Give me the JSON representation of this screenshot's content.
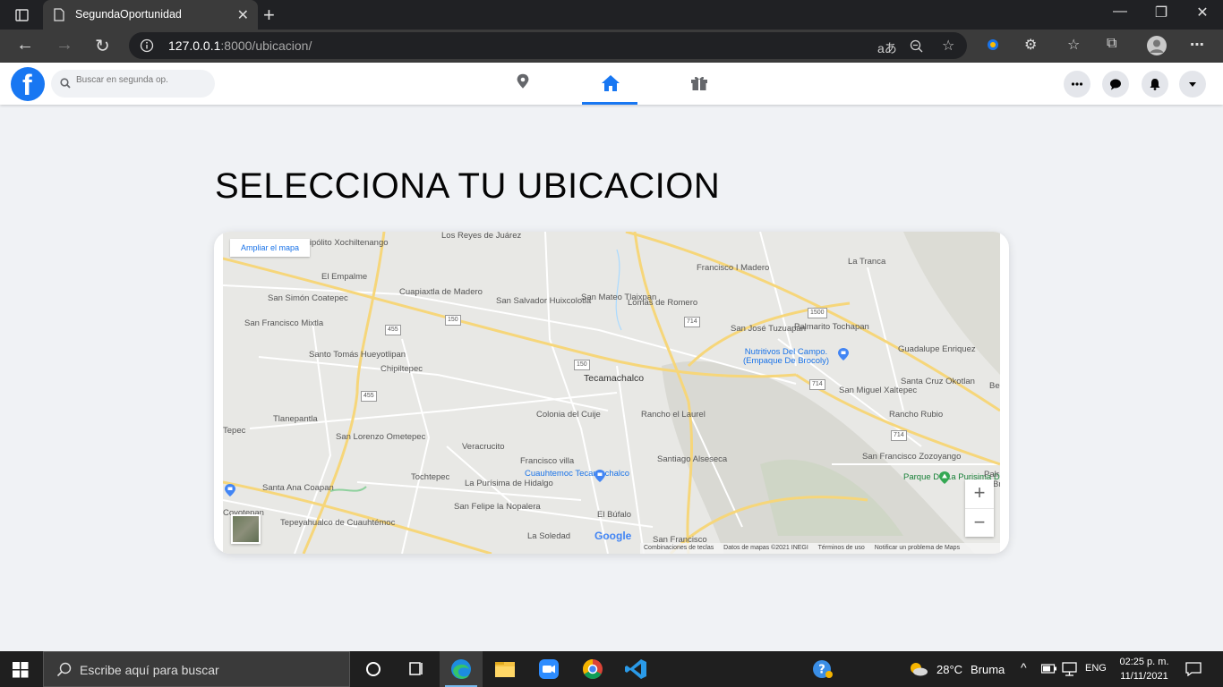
{
  "browser": {
    "tab_title": "SegundaOportunidad",
    "url_host": "127.0.0.1",
    "url_path": ":8000/ubicacion/",
    "read_aloud": "aあ"
  },
  "app": {
    "logo_letter": "f",
    "search_placeholder": "Buscar en segunda op.",
    "brand_color": "#1877f2"
  },
  "page": {
    "title": "SELECCIONA TU UBICACION"
  },
  "map": {
    "ampliar_label": "Ampliar el mapa",
    "zoom_in": "+",
    "zoom_out": "−",
    "google_logo": "Google",
    "attribution": [
      "Combinaciones de teclas",
      "Datos de mapas ©2021 INEGI",
      "Términos de uso",
      "Notificar un problema de Maps"
    ],
    "places": [
      "Los Reyes de Juárez",
      "Hipólito Xochiltenango",
      "El Empalme",
      "Cuapiaxtla de Madero",
      "San Salvador Huixcolotla",
      "San Mateo Tlaixpan",
      "Lomas de Romero",
      "Francisco I Madero",
      "La Tranca",
      "San Simón Coatepec",
      "San Francisco Mixtla",
      "Santo Tomás Hueyotlipan",
      "Chipiltepec",
      "Tecamachalco",
      "San José Tuzuapan",
      "Palmarito Tochapan",
      "Guadalupe Enriquez",
      "Nutritivos Del Campo. (Empaque De Brocoly)",
      "San Miguel Xaltepec",
      "Santa Cruz Okotlan",
      "Rancho Rubio",
      "Colonia del Cuije",
      "Rancho el Laurel",
      "Tlanepantla",
      "Tepec",
      "San Lorenzo Ometepec",
      "Veracrucito",
      "Francisco villa",
      "Cuauhtemoc Tecamachalco",
      "Santiago Alseseca",
      "San Francisco Zozoyango",
      "Parque De La Purisima De Bravo",
      "Tochtepec",
      "La Purísima de Hidalgo",
      "Santa Ana Coapan",
      "San Felipe la Nopalera",
      "Tepeyahualco de Cuauhtémoc",
      "El Búfalo",
      "La Soledad",
      "San Francisco",
      "Be",
      "Palr",
      "Br",
      "Coyotepan"
    ],
    "roads": [
      "150",
      "455",
      "455",
      "150",
      "714",
      "1500",
      "714",
      "714"
    ]
  },
  "taskbar": {
    "search_placeholder": "Escribe aquí para buscar",
    "weather_temp": "28°C",
    "weather_desc": "Bruma",
    "lang": "ENG",
    "time": "02:25 p. m.",
    "date": "11/11/2021"
  }
}
